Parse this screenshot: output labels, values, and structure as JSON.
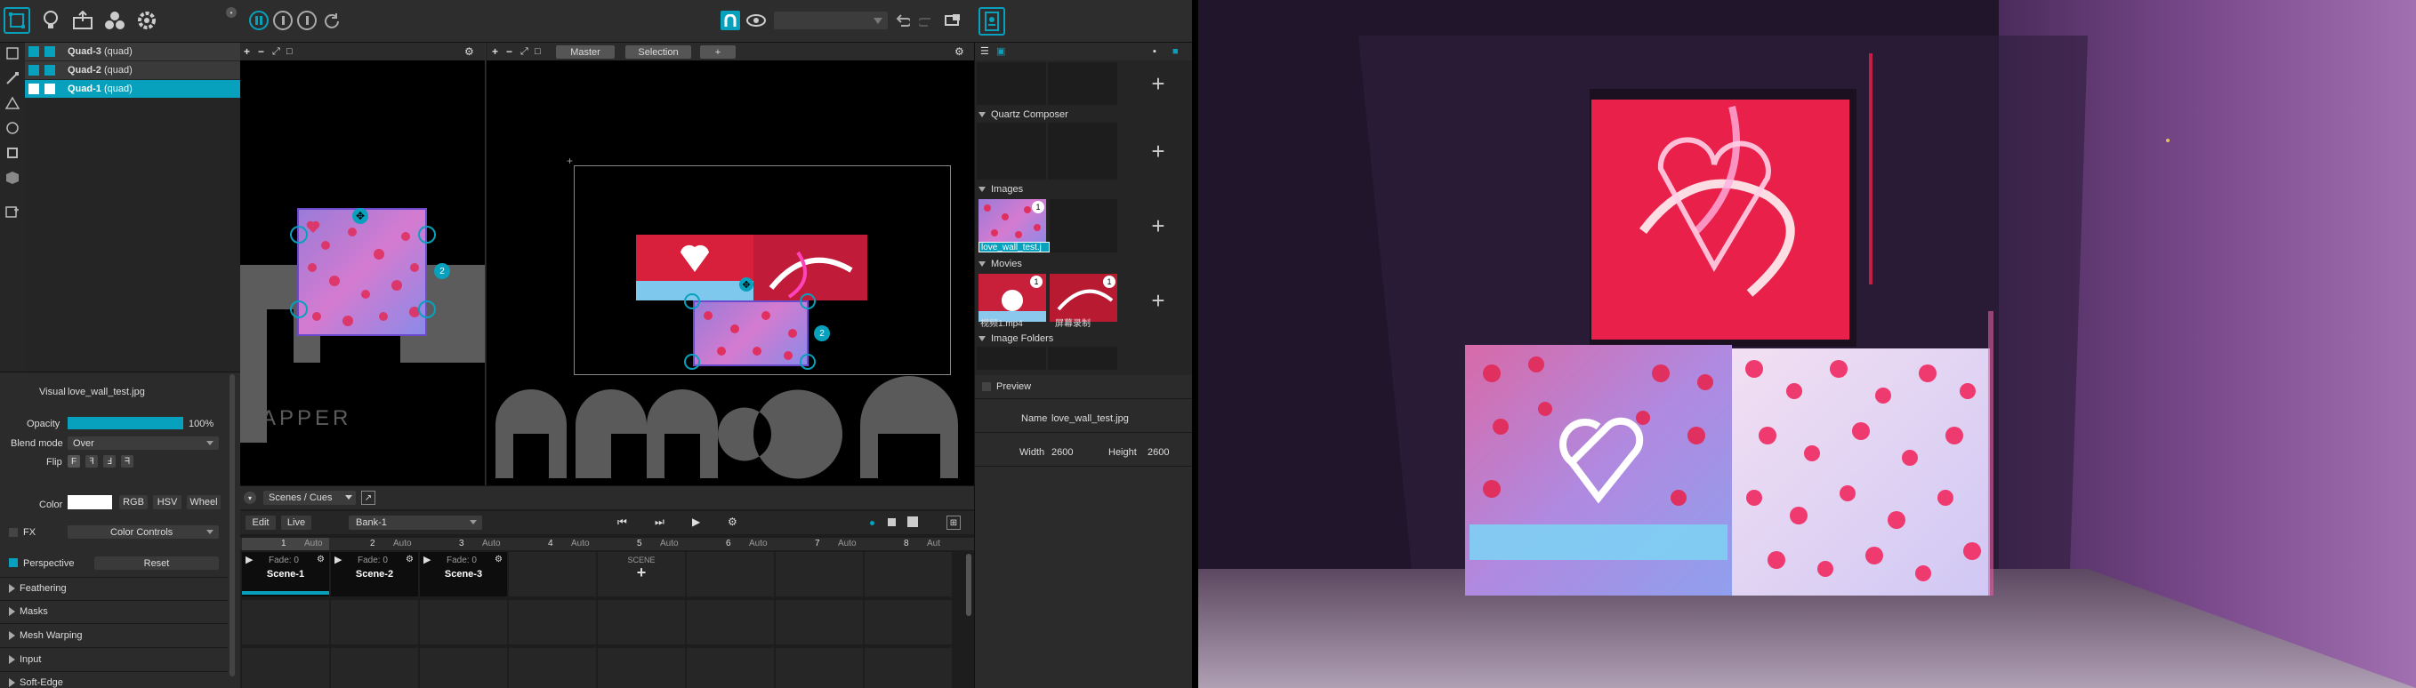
{
  "layers": [
    {
      "name": "Quad-3",
      "type": "(quad)"
    },
    {
      "name": "Quad-2",
      "type": "(quad)"
    },
    {
      "name": "Quad-1",
      "type": "(quad)"
    }
  ],
  "input_view": {
    "brand": "MAPPER"
  },
  "output_view": {
    "tabs": [
      "Master",
      "Selection",
      "+"
    ]
  },
  "properties": {
    "visual_label": "Visual",
    "visual_value": "love_wall_test.jpg",
    "opacity_label": "Opacity",
    "opacity_percent": "100%",
    "opacity_fraction": 1.0,
    "blend_label": "Blend mode",
    "blend_value": "Over",
    "flip_label": "Flip",
    "flip_buttons": [
      "F",
      "ꟻ",
      "Ⅎ",
      "ᖷ"
    ],
    "color_label": "Color",
    "color_swatch": "#ffffff",
    "color_modes": [
      "RGB",
      "HSV",
      "Wheel"
    ],
    "fx_label": "FX",
    "fx_value": "Color Controls",
    "perspective_label": "Perspective",
    "reset_label": "Reset",
    "sections": [
      "Feathering",
      "Masks",
      "Mesh Warping",
      "Input",
      "Soft-Edge"
    ]
  },
  "cues": {
    "dropdown": "Scenes / Cues",
    "edit": "Edit",
    "live": "Live",
    "bank": "Bank-1",
    "columns": [
      {
        "num": "1",
        "mode": "Auto"
      },
      {
        "num": "2",
        "mode": "Auto"
      },
      {
        "num": "3",
        "mode": "Auto"
      },
      {
        "num": "4",
        "mode": "Auto"
      },
      {
        "num": "5",
        "mode": "Auto"
      },
      {
        "num": "6",
        "mode": "Auto"
      },
      {
        "num": "7",
        "mode": "Auto"
      },
      {
        "num": "8",
        "mode": "Aut"
      }
    ],
    "scenes": [
      {
        "fade": "Fade: 0",
        "name": "Scene-1"
      },
      {
        "fade": "Fade: 0",
        "name": "Scene-2"
      },
      {
        "fade": "Fade: 0",
        "name": "Scene-3"
      }
    ],
    "new_scene": "SCENE"
  },
  "library": {
    "quartz": "Quartz Composer",
    "images": "Images",
    "image_item": "love_wall_test.j",
    "image_count": "1",
    "movies": "Movies",
    "movie_items": [
      {
        "name": "视频1.mp4",
        "count": "1"
      },
      {
        "name": "屏幕录制",
        "count": "1"
      }
    ],
    "folders": "Image Folders",
    "preview": "Preview",
    "name_label": "Name",
    "name_value": "love_wall_test.jpg",
    "width_label": "Width",
    "width_value": "2600",
    "height_label": "Height",
    "height_value": "2600"
  },
  "colors": {
    "accent": "#08a1bd",
    "toolbar": "#2d2d2d",
    "panel": "#252525",
    "canvas": "#000000"
  }
}
